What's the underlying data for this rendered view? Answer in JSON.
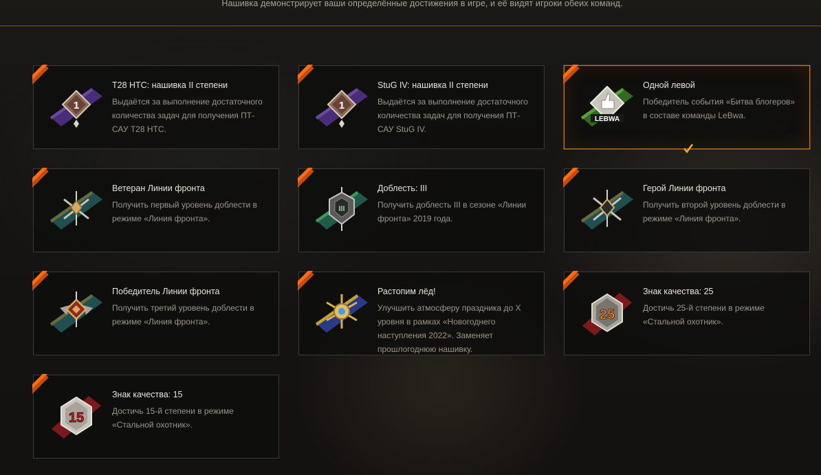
{
  "header": {
    "description": "Нашивка демонстрирует ваши определённые достижения в игре, и её видят игроки обеих команд."
  },
  "cards": [
    {
      "title": "T28 HTC: нашивка II степени",
      "description": "Выдаётся за выполнение достаточного количества задач для получения ПТ-САУ T28 HTC.",
      "icon": "rank-diamond-badge-icon",
      "badge_text": "1",
      "ribbon_color": "#5a3a8c",
      "selected": false
    },
    {
      "title": "StuG IV: нашивка II степени",
      "description": "Выдаётся за выполнение достаточного количества задач для получения ПТ-САУ StuG IV.",
      "icon": "rank-diamond-badge-icon",
      "badge_text": "1",
      "ribbon_color": "#5a3a8c",
      "selected": false
    },
    {
      "title": "Одной левой",
      "description": "Победитель события «Битва блогеров» в составе команды LeBwa.",
      "icon": "lebwa-thumbs-up-badge-icon",
      "badge_text": "LEBWA",
      "ribbon_color": "#3f8a2a",
      "selected": true
    },
    {
      "title": "Ветеран Линии фронта",
      "description": "Получить первый уровень доблести в режиме «Линия фронта».",
      "icon": "crossed-swords-badge-icon",
      "badge_text": "",
      "ribbon_color": "#1f5a5a",
      "selected": false
    },
    {
      "title": "Доблесть: III",
      "description": "Получить доблесть III в сезоне «Линии фронта» 2019 года.",
      "icon": "valor-shield-badge-icon",
      "badge_text": "III",
      "ribbon_color": "#2a6a4a",
      "selected": false
    },
    {
      "title": "Герой Линии фронта",
      "description": "Получить второй уровень доблести в режиме «Линия фронта».",
      "icon": "crossed-swords-badge-icon",
      "badge_text": "",
      "ribbon_color": "#1f5a5a",
      "selected": false
    },
    {
      "title": "Победитель Линии фронта",
      "description": "Получить третий уровень доблести в режиме «Линия фронта».",
      "icon": "winged-star-badge-icon",
      "badge_text": "",
      "ribbon_color": "#1f5a5a",
      "selected": false
    },
    {
      "title": "Растопим лёд!",
      "description": "Улучшить атмосферу праздника до X уровня в рамках «Новогоднего наступления 2022». Заменяет прошлогоднюю нашивку.",
      "icon": "snowflake-badge-icon",
      "badge_text": "",
      "ribbon_color": "#2a4a9a",
      "selected": false
    },
    {
      "title": "Знак качества: 25",
      "description": "Достичь 25-й степени в режиме «Стальной охотник».",
      "icon": "steel-hunter-badge-icon",
      "badge_text": "25",
      "ribbon_color": "#8a1f1f",
      "selected": false
    },
    {
      "title": "Знак качества: 15",
      "description": "Достичь 15-й степени в режиме «Стальной охотник».",
      "icon": "steel-hunter-badge-icon",
      "badge_text": "15",
      "ribbon_color": "#8a1f1f",
      "selected": false
    }
  ],
  "colors": {
    "accent_orange": "#e2631a",
    "selected_border": "#c8761f",
    "check_yellow": "#f0b020"
  }
}
